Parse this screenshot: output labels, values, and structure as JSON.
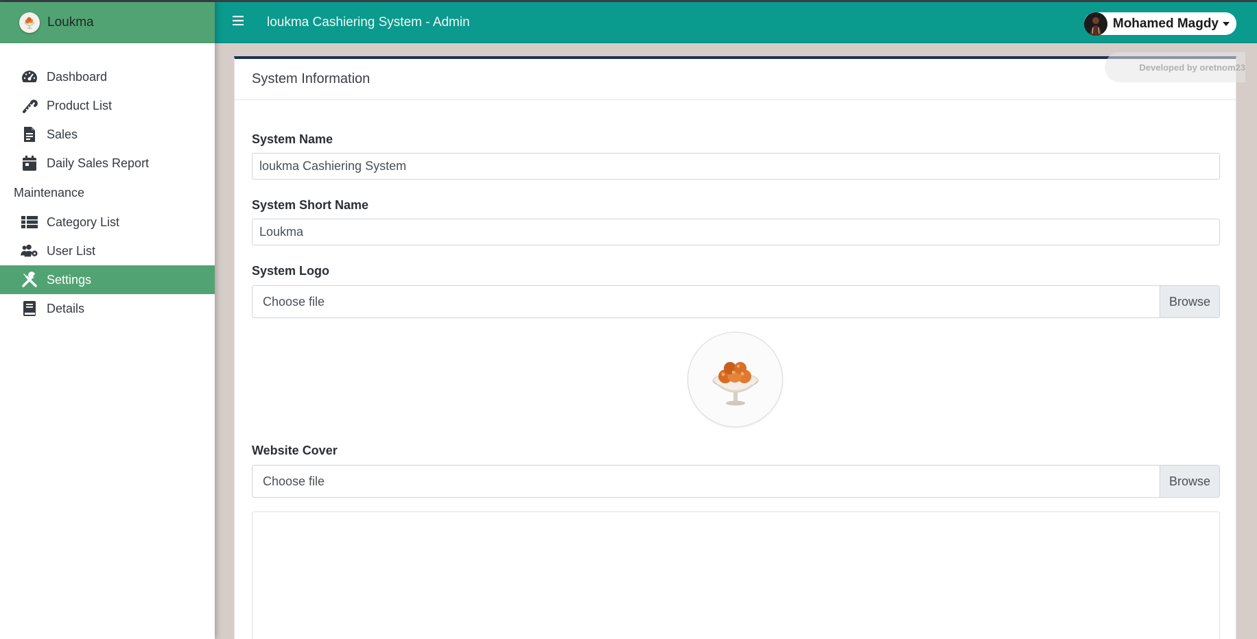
{
  "brand": {
    "name": "Loukma"
  },
  "navbar": {
    "title": "loukma Cashiering System - Admin",
    "user_name": "Mohamed Magdy"
  },
  "sidebar": {
    "items": [
      {
        "label": "Dashboard",
        "icon": "dashboard-gauge-icon"
      },
      {
        "label": "Product List",
        "icon": "candy-cane-icon"
      },
      {
        "label": "Sales",
        "icon": "file-invoice-icon"
      },
      {
        "label": "Daily Sales Report",
        "icon": "calendar-icon"
      }
    ],
    "section_header": "Maintenance",
    "maintenance_items": [
      {
        "label": "Category List",
        "icon": "list-icon"
      },
      {
        "label": "User List",
        "icon": "users-cog-icon"
      },
      {
        "label": "Settings",
        "icon": "tools-icon",
        "active": true
      },
      {
        "label": "Details",
        "icon": "book-icon"
      }
    ]
  },
  "card": {
    "title": "System Information",
    "developer_badge": "Developed by oretnom23",
    "fields": {
      "system_name_label": "System Name",
      "system_name_value": "loukma Cashiering System",
      "short_name_label": "System Short Name",
      "short_name_value": "Loukma",
      "logo_label": "System Logo",
      "logo_file_text": "Choose file",
      "logo_browse": "Browse",
      "cover_label": "Website Cover",
      "cover_file_text": "Choose file",
      "cover_browse": "Browse"
    }
  },
  "colors": {
    "navbar": "#0a9a8e",
    "sidebar_brand": "#52a373",
    "active_item": "#52a373",
    "card_top_border": "#1d2f55",
    "page_background": "#d6cdc8"
  }
}
